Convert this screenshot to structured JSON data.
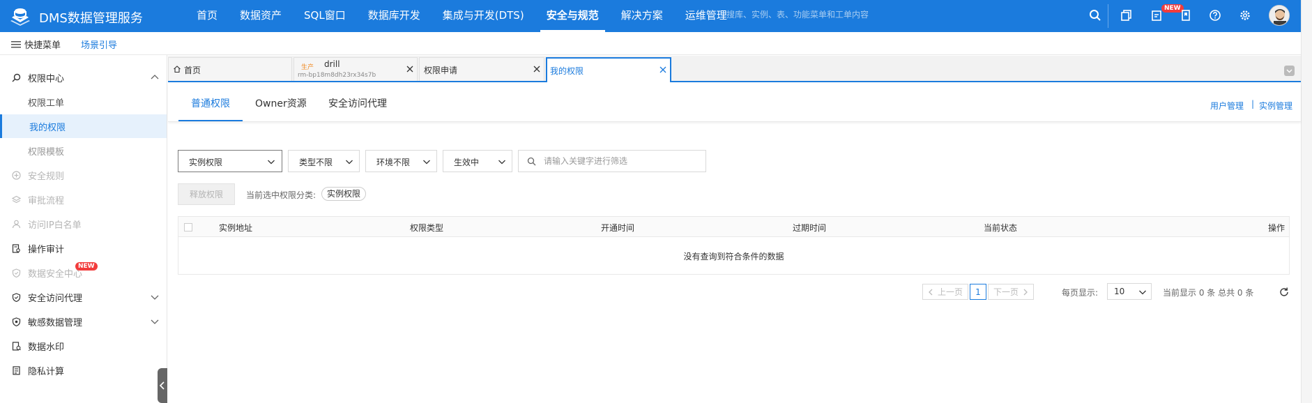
{
  "app": {
    "brand": "DMS数据管理服务"
  },
  "nav": {
    "items": [
      "首页",
      "数据资产",
      "SQL窗口",
      "数据库开发",
      "集成与开发(DTS)",
      "安全与规范",
      "解决方案",
      "运维管理"
    ],
    "active_index": 5
  },
  "top_search": {
    "placeholder": "搜库、实例、表、功能菜单和工单内容"
  },
  "top_icons": {
    "new_badge": "NEW"
  },
  "quickbar": {
    "quick_menu": "快捷菜单",
    "scene_guide": "场景引导"
  },
  "sidebar": {
    "items": [
      {
        "label": "权限中心",
        "icon": "search-icon",
        "state": "normal",
        "expanded": true
      },
      {
        "label": "权限工单",
        "state": "sub"
      },
      {
        "label": "我的权限",
        "state": "selected"
      },
      {
        "label": "权限模板",
        "state": "sub"
      },
      {
        "label": "安全规则",
        "icon": "plus-circle-icon",
        "state": "disabled"
      },
      {
        "label": "审批流程",
        "icon": "layers-icon",
        "state": "disabled"
      },
      {
        "label": "访问IP白名单",
        "icon": "user-icon",
        "state": "disabled"
      },
      {
        "label": "操作审计",
        "icon": "audit-icon",
        "state": "normal"
      },
      {
        "label": "数据安全中心",
        "icon": "shield-icon",
        "state": "disabled",
        "badge": "NEW"
      },
      {
        "label": "安全访问代理",
        "icon": "shield-check-icon",
        "state": "normal",
        "collapsed": true
      },
      {
        "label": "敏感数据管理",
        "icon": "sensitive-shield-icon",
        "state": "normal",
        "collapsed": true
      },
      {
        "label": "数据水印",
        "icon": "watermark-icon",
        "state": "normal"
      },
      {
        "label": "隐私计算",
        "icon": "document-icon",
        "state": "normal"
      }
    ]
  },
  "tabs": {
    "home": "首页",
    "drill": {
      "env": "生产",
      "title": "drill",
      "sub": "rm-bp18m8dh23rx34s7b"
    },
    "apply": "权限申请",
    "mine": "我的权限"
  },
  "subtabs": {
    "items": [
      "普通权限",
      "Owner资源",
      "安全访问代理"
    ],
    "active_index": 0
  },
  "links": {
    "user_manage": "用户管理",
    "sep": "|",
    "instance_manage": "实例管理"
  },
  "filters": {
    "perm_type": "实例权限",
    "type": "类型不限",
    "env": "环境不限",
    "status": "生效中",
    "search_placeholder": "请输入关键字进行筛选"
  },
  "actions": {
    "release": "释放权限",
    "category_label": "当前选中权限分类:",
    "category_tag": "实例权限"
  },
  "table": {
    "columns": [
      "实例地址",
      "权限类型",
      "开通时间",
      "过期时间",
      "当前状态",
      "操作"
    ],
    "empty_text": "没有查询到符合条件的数据"
  },
  "pagination": {
    "prev": "上一页",
    "page": "1",
    "next": "下一页",
    "page_size_label": "每页显示:",
    "page_size": "10",
    "summary": "当前显示 0 条 总共 0 条"
  },
  "colors": {
    "primary": "#1b7bdd",
    "badge": "#f23c3c",
    "env_tag": "#f08a24"
  }
}
